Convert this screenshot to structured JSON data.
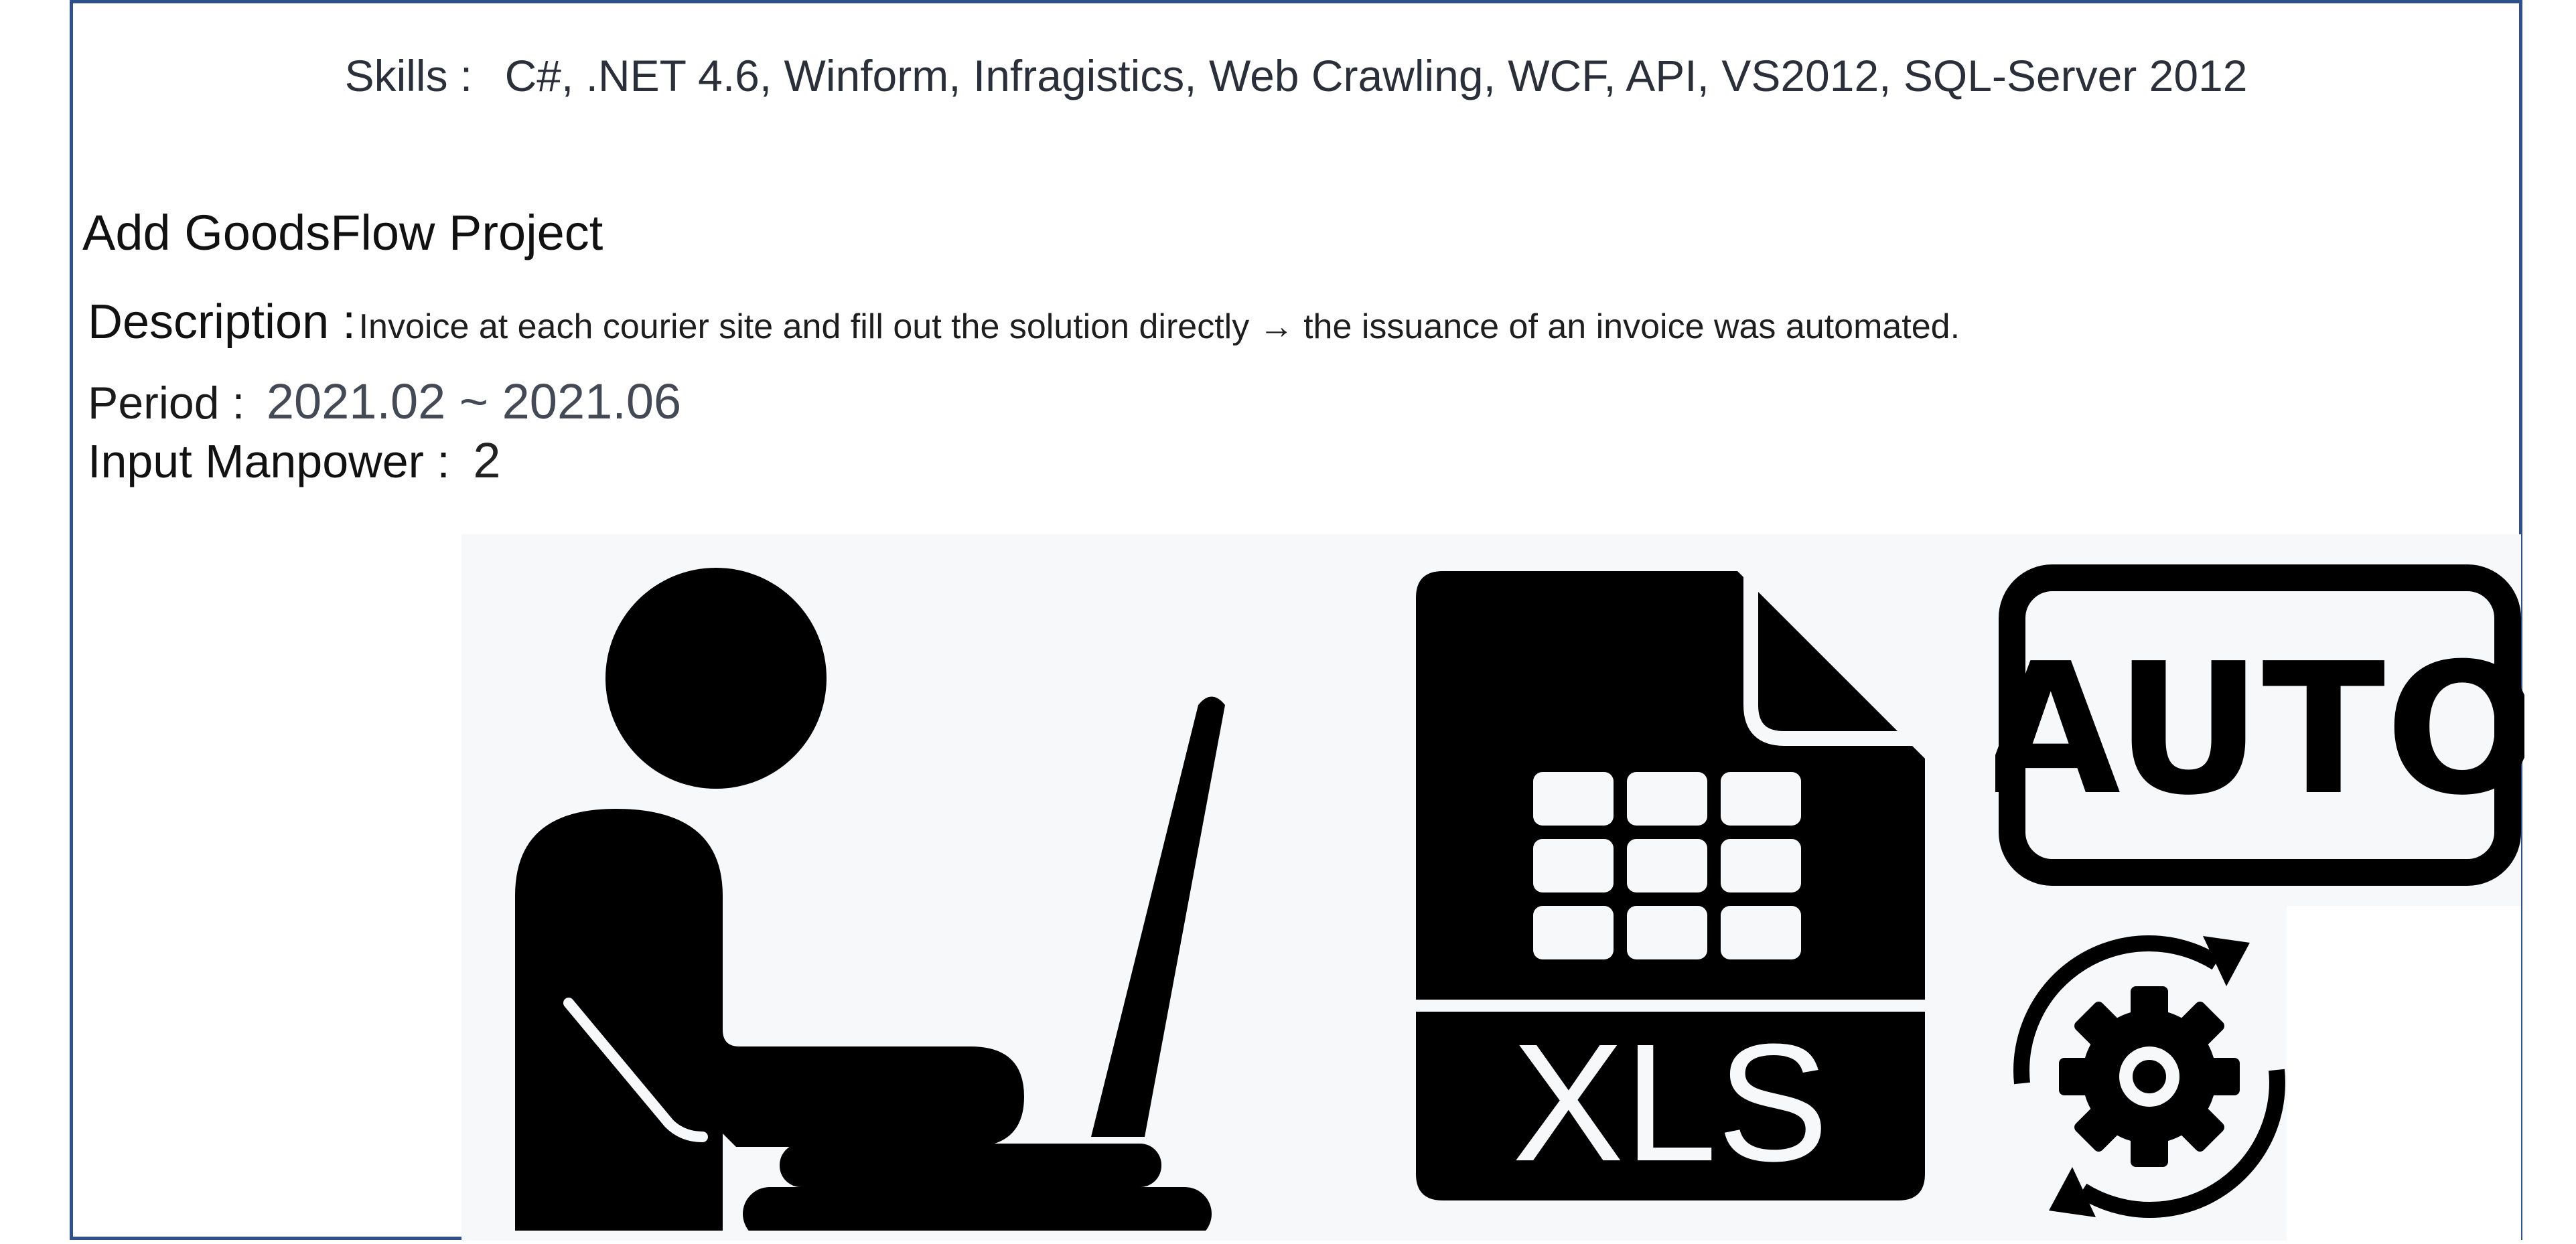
{
  "skills": {
    "label": "Skills :",
    "value": "C#, .NET 4.6, Winform, Infragistics, Web Crawling, WCF, API, VS2012, SQL-Server 2012"
  },
  "project": {
    "title": "Add GoodsFlow Project",
    "description_label": "Description :",
    "description_value": "Invoice at each courier site and fill out the solution directly  → the issuance of an invoice was automated.",
    "period_label": "Period :",
    "period_value": "2021.02 ~ 2021.06",
    "manpower_label": "Input Manpower :",
    "manpower_value": "2"
  },
  "illustration": {
    "icons": [
      "person-laptop-icon",
      "xls-file-icon",
      "auto-badge-icon",
      "gear-sync-icon"
    ],
    "xls_text": "XLS",
    "auto_text": "AUTO",
    "colors": {
      "background": "#f7f8fa",
      "icon": "#000000",
      "frame": "#2f4f8f"
    }
  }
}
